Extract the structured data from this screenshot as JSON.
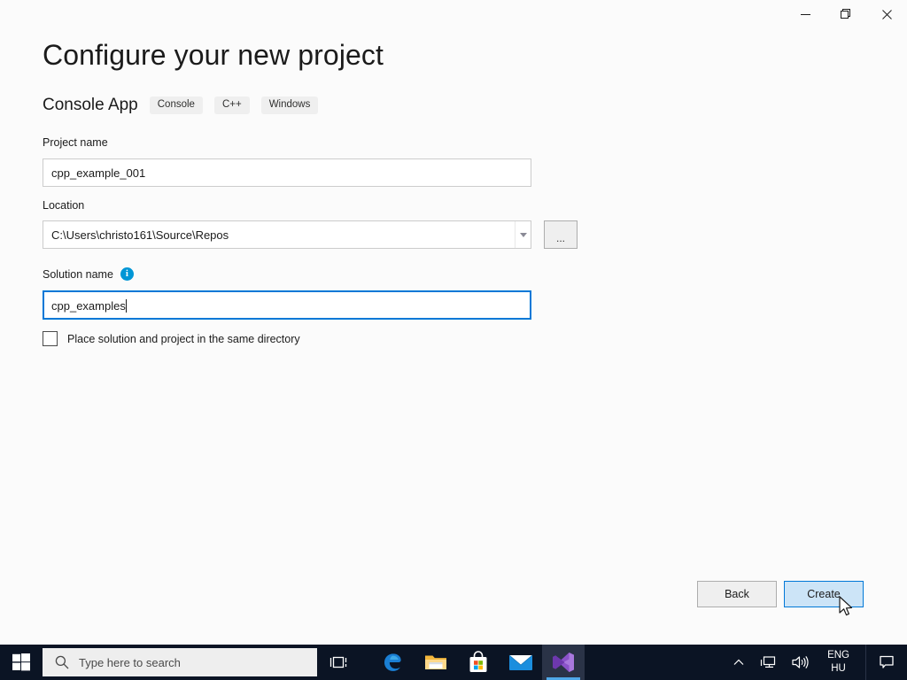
{
  "window": {
    "controls": [
      {
        "name": "minimize",
        "label": "Minimize"
      },
      {
        "name": "restore",
        "label": "Restore Down"
      },
      {
        "name": "close",
        "label": "Close"
      }
    ]
  },
  "page": {
    "title": "Configure your new project",
    "template_name": "Console App",
    "tags": [
      "Console",
      "C++",
      "Windows"
    ]
  },
  "form": {
    "project_name": {
      "label": "Project name",
      "value": "cpp_example_001",
      "placeholder": ""
    },
    "location": {
      "label": "Location",
      "value": "C:\\Users\\christo161\\Source\\Repos",
      "placeholder": "",
      "browse_label": "..."
    },
    "solution_name": {
      "label": "Solution name",
      "value": "cpp_examples",
      "placeholder": "",
      "info_glyph": "i",
      "focused": true
    },
    "same_directory": {
      "label": "Place solution and project in the same directory",
      "checked": false
    }
  },
  "footer": {
    "back_label": "Back",
    "create_label": "Create"
  },
  "taskbar": {
    "search_placeholder": "Type here to search",
    "apps": [
      {
        "name": "edge",
        "label": "Microsoft Edge"
      },
      {
        "name": "file-explorer",
        "label": "File Explorer"
      },
      {
        "name": "microsoft-store",
        "label": "Microsoft Store"
      },
      {
        "name": "mail",
        "label": "Mail"
      },
      {
        "name": "visual-studio",
        "label": "Visual Studio",
        "active": true
      }
    ],
    "tray": {
      "language_primary": "ENG",
      "language_secondary": "HU"
    }
  },
  "colors": {
    "accent": "#0078d7",
    "button_highlight": "#cce4f7",
    "info_icon": "#0096d6",
    "taskbar": "#0b1424",
    "page_background": "#fbfbfb"
  }
}
